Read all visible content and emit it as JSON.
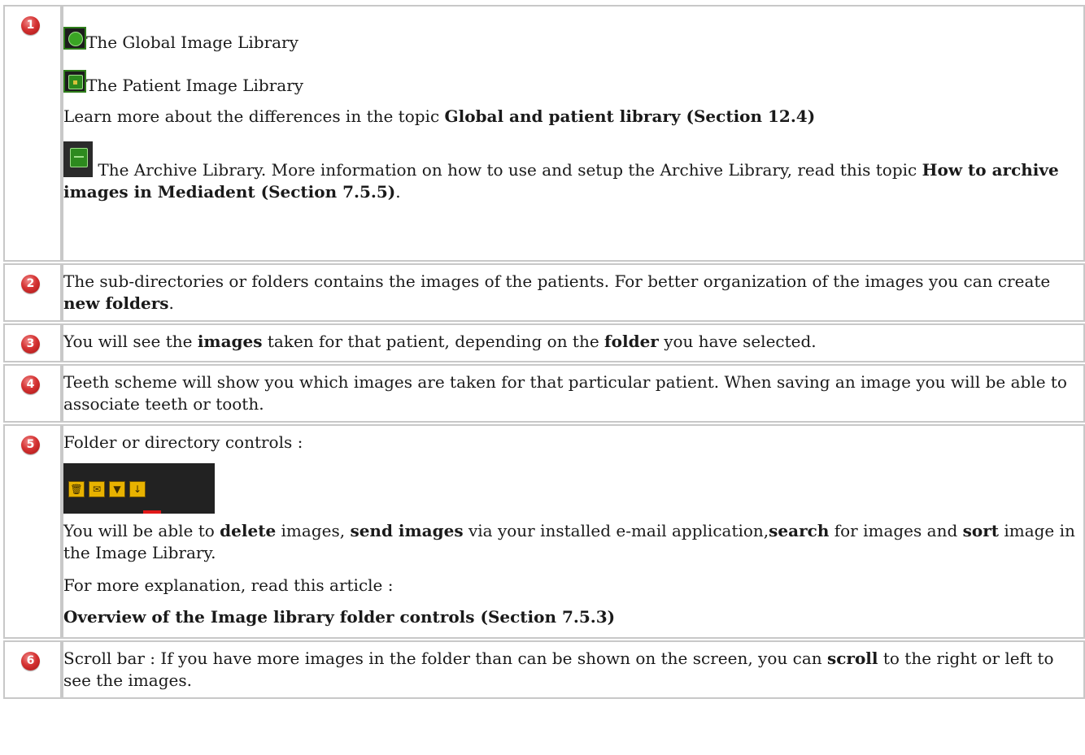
{
  "rows": [
    {
      "num": "1",
      "global_lib": "The Global Image Library",
      "patient_lib": "The Patient Image Library",
      "learn_prefix": "Learn more about the differences in the topic ",
      "learn_link": "Global and patient library (Section 12.4)",
      "archive_prefix": " The Archive Library. More information on how to use and setup the Archive Library, read this topic ",
      "archive_link": "How to archive images in Mediadent (Section 7.5.5)",
      "archive_suffix": "."
    },
    {
      "num": "2",
      "text_prefix": "The sub-directories or folders contains the images of the patients. For better organization of the images you can create ",
      "text_bold": "new folders",
      "text_suffix": "."
    },
    {
      "num": "3",
      "p1": "You will see the ",
      "b1": "images",
      "p2": " taken for that patient, depending on the ",
      "b2": "folder",
      "p3": " you have selected."
    },
    {
      "num": "4",
      "text": "Teeth scheme will show you which images are taken for that particular patient. When saving an image you will be able to associate teeth or tooth."
    },
    {
      "num": "5",
      "heading": "Folder or directory controls :",
      "s1": "You will be able to ",
      "b1": "delete",
      "s2": " images, ",
      "b2": "send images",
      "s3": " via your installed e-mail application,",
      "b3": "search",
      "s4": " for images and ",
      "b4": "sort",
      "s5": " image in the Image Library.",
      "more": "For more explanation, read this article :",
      "link": "Overview of the Image library folder controls (Section 7.5.3)"
    },
    {
      "num": "6",
      "s1": "Scroll bar : If you have more images in the folder than can be shown on the screen, you can ",
      "b1": "scroll",
      "s2": " to the right or left to see the images."
    }
  ],
  "icons": [
    "globe-icon",
    "lock-icon",
    "archive-icon",
    "trash-icon",
    "mail-icon",
    "filter-icon",
    "sort-down-icon"
  ]
}
